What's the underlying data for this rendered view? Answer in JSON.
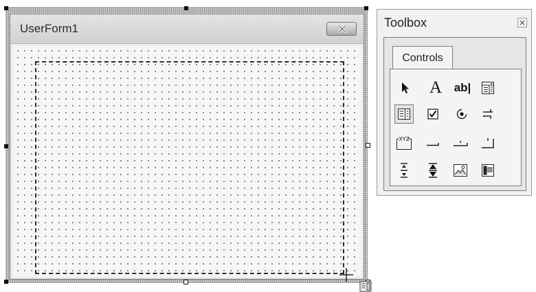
{
  "form": {
    "title": "UserForm1",
    "close_icon": "close-icon"
  },
  "toolbox": {
    "title": "Toolbox",
    "close_icon": "close-icon",
    "tabs": [
      {
        "label": "Controls",
        "active": true
      }
    ],
    "tools": [
      {
        "name": "select-objects",
        "icon": "pointer-arrow-icon"
      },
      {
        "name": "label",
        "icon": "label-A-icon",
        "glyph": "A"
      },
      {
        "name": "textbox",
        "icon": "textbox-icon",
        "glyph": "ab|"
      },
      {
        "name": "combobox",
        "icon": "combobox-icon"
      },
      {
        "name": "listbox",
        "icon": "listbox-icon",
        "selected": true
      },
      {
        "name": "checkbox",
        "icon": "checkbox-icon"
      },
      {
        "name": "optionbutton",
        "icon": "option-button-icon"
      },
      {
        "name": "togglebutton",
        "icon": "toggle-button-icon"
      },
      {
        "name": "frame",
        "icon": "frame-icon",
        "glyph": "XYZ"
      },
      {
        "name": "commandbutton",
        "icon": "command-button-icon"
      },
      {
        "name": "tabstrip",
        "icon": "tabstrip-icon"
      },
      {
        "name": "multipage",
        "icon": "multipage-icon"
      },
      {
        "name": "scrollbar",
        "icon": "scrollbar-icon"
      },
      {
        "name": "spinbutton",
        "icon": "spin-button-icon"
      },
      {
        "name": "image",
        "icon": "image-icon"
      },
      {
        "name": "refedit",
        "icon": "refedit-icon"
      }
    ]
  },
  "colors": {
    "form_bg": "#efefef",
    "grid_dot": "#6a6a6a",
    "marquee": "#2b2b2b",
    "toolbox_bg": "#f1f1f1"
  }
}
